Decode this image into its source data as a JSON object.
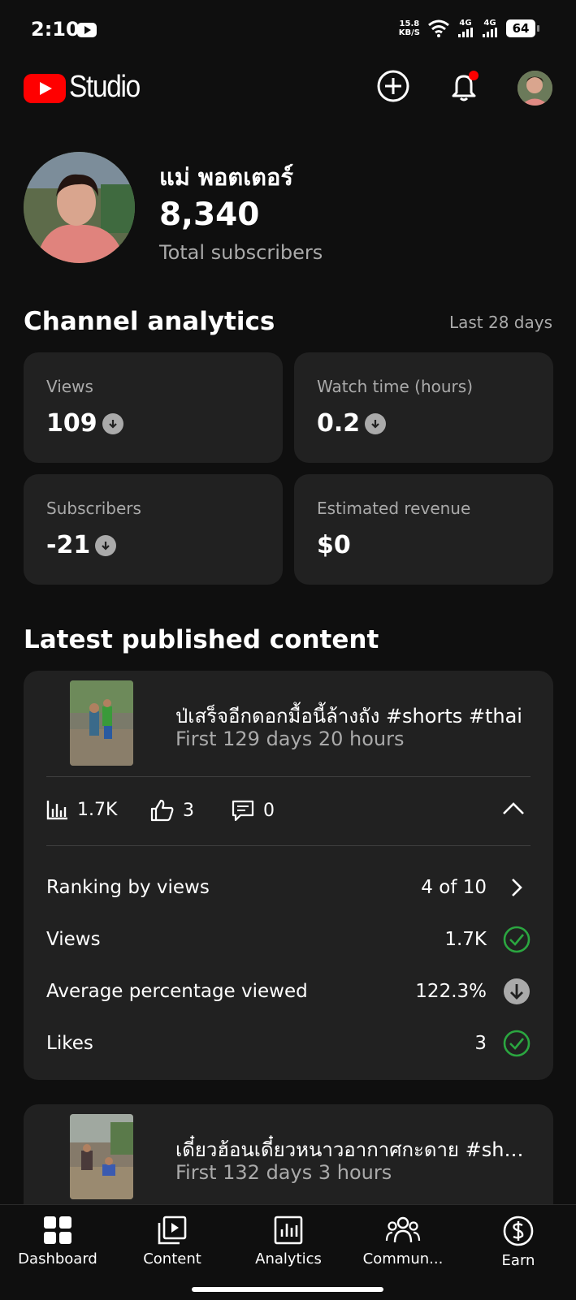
{
  "status_bar": {
    "time": "2:10",
    "net_speed_value": "15.8",
    "net_speed_unit": "KB/S",
    "signal1": "4G",
    "signal2": "4G",
    "battery": "64"
  },
  "header": {
    "logo_text": "Studio",
    "icons": [
      "add-icon",
      "notifications-icon",
      "account-avatar"
    ],
    "notification_dot_color": "#ff0000"
  },
  "channel": {
    "name": "แม่ พอตเตอร์",
    "subscribers": "8,340",
    "subscribers_label": "Total subscribers"
  },
  "analytics": {
    "title": "Channel analytics",
    "period": "Last 28 days",
    "metrics": [
      {
        "label": "Views",
        "value": "109",
        "trend": "down"
      },
      {
        "label": "Watch time (hours)",
        "value": "0.2",
        "trend": "down"
      },
      {
        "label": "Subscribers",
        "value": "-21",
        "trend": "down"
      },
      {
        "label": "Estimated revenue",
        "value": "$0",
        "trend": "none"
      }
    ]
  },
  "latest": {
    "title": "Latest published content",
    "items": [
      {
        "title": "ป่เสร็จอีกดอกมื้อนี้ล้างถัง  #shorts #thai",
        "age": "First 129 days 20 hours",
        "views": "1.7K",
        "likes": "3",
        "comments": "0",
        "details": [
          {
            "label": "Ranking by views",
            "value": "4 of 10",
            "icon": "chevron-right-icon"
          },
          {
            "label": "Views",
            "value": "1.7K",
            "icon": "check-circle-icon"
          },
          {
            "label": "Average percentage viewed",
            "value": "122.3%",
            "icon": "down-circle-icon"
          },
          {
            "label": "Likes",
            "value": "3",
            "icon": "check-circle-icon"
          }
        ]
      },
      {
        "title": "เดี๋ยวฮ้อนเดี๋ยวหนาวอากาศกะดาย #shorts",
        "age": "First 132 days 3 hours"
      }
    ]
  },
  "colors": {
    "background": "#0f0f0f",
    "card": "#212121",
    "success": "#2ba640",
    "brand_red": "#ff0000"
  },
  "nav": [
    {
      "label": "Dashboard",
      "icon": "dashboard-icon",
      "active": true
    },
    {
      "label": "Content",
      "icon": "content-icon"
    },
    {
      "label": "Analytics",
      "icon": "analytics-icon"
    },
    {
      "label": "Commun...",
      "icon": "community-icon"
    },
    {
      "label": "Earn",
      "icon": "earn-icon"
    }
  ]
}
